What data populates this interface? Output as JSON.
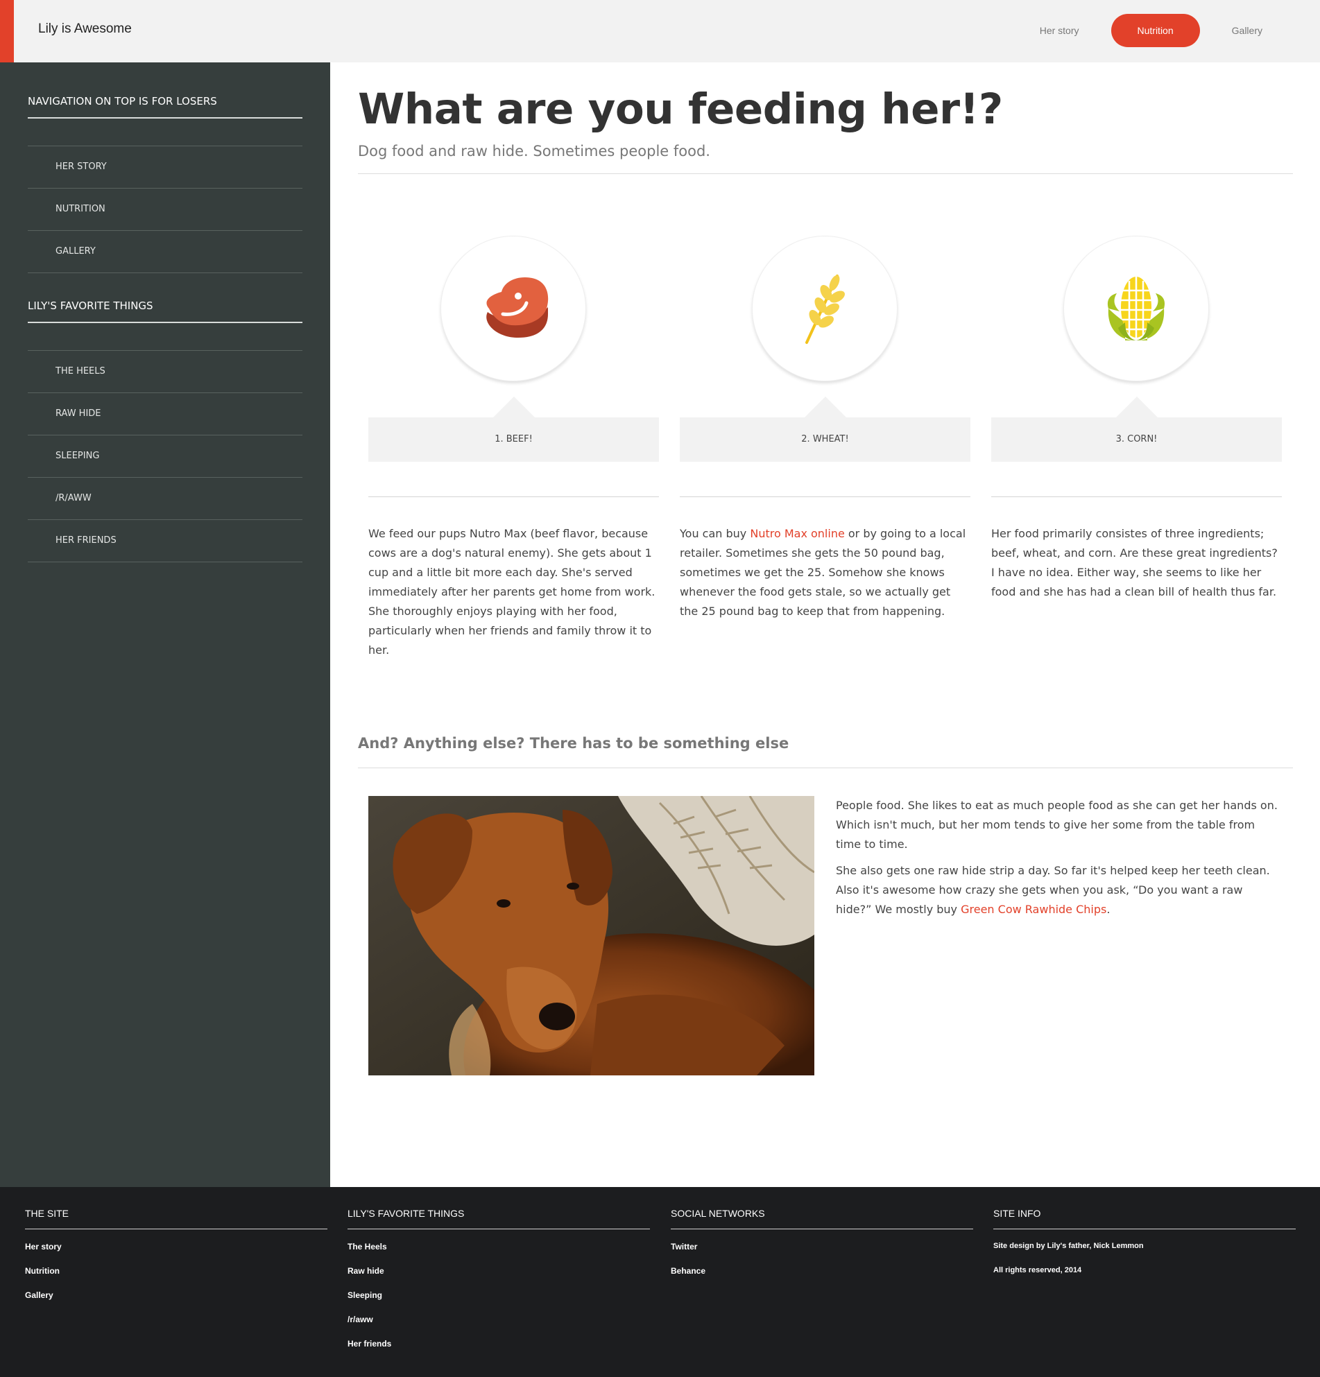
{
  "header": {
    "brand": "Lily is Awesome",
    "nav": [
      {
        "label": "Her story",
        "active": false
      },
      {
        "label": "Nutrition",
        "active": true
      },
      {
        "label": "Gallery",
        "active": false
      }
    ]
  },
  "sidebar": {
    "section1_title": "Navigation on top is for losers",
    "section1_items": [
      "Her story",
      "Nutrition",
      "Gallery"
    ],
    "section2_title": "Lily's favorite things",
    "section2_items": [
      "The heels",
      "Raw hide",
      "Sleeping",
      "/r/aww",
      "Her friends"
    ]
  },
  "main": {
    "title": "What are you feeding her!?",
    "subtitle": "Dog food and raw hide. Sometimes people food.",
    "features": [
      {
        "icon": "steak-icon",
        "label": "1. Beef!",
        "text": "We feed our pups Nutro Max (beef flavor, because cows are a dog's natural enemy). She gets about 1 cup and a little bit more each day. She's served immediately after her parents get home from work. She thoroughly enjoys playing with her food, particularly when her friends and family throw it to her."
      },
      {
        "icon": "wheat-icon",
        "label": "2. Wheat!",
        "text_before": "You can buy ",
        "link": "Nutro Max online",
        "text_after": " or by going to a local retailer. Sometimes she gets the 50 pound bag, sometimes we get the 25. Somehow she knows whenever the food gets stale, so we actually get the 25 pound bag to keep that from happening."
      },
      {
        "icon": "corn-icon",
        "label": "3. Corn!",
        "text": "Her food primarily consistes of three ingredients; beef, wheat, and corn. Are these great ingredients? I have no idea. Either way, she seems to like her food and she has had a clean bill of health thus far."
      }
    ],
    "section2_title": "And? Anything else? There has to be something else",
    "para1": "People food. She likes to eat as much people food as she can get her hands on. Which isn't much, but her mom tends to give her some from the table from time to time.",
    "para2_before": "She also gets one raw hide strip a day. So far it's helped keep her teeth clean. Also it's awesome how crazy she gets when you ask, “Do you want a raw hide?” We mostly buy ",
    "para2_link": "Green Cow Rawhide Chips",
    "para2_after": "."
  },
  "footer": {
    "col1": {
      "title": "The site",
      "items": [
        "Her story",
        "Nutrition",
        "Gallery"
      ]
    },
    "col2": {
      "title": "Lily's favorite things",
      "items": [
        "The Heels",
        "Raw hide",
        "Sleeping",
        "/r/aww",
        "Her friends"
      ]
    },
    "col3": {
      "title": "Social networks",
      "items": [
        "Twitter",
        "Behance"
      ]
    },
    "col4": {
      "title": "Site info",
      "credit_prefix": "Site design by Lily's father, ",
      "credit_name": "Nick Lemmon",
      "rights": "All rights reserved, 2014"
    }
  },
  "colors": {
    "accent": "#e2412a",
    "sidebar": "#363e3d",
    "footer": "#1c1d1f",
    "header": "#f2f2f2"
  }
}
